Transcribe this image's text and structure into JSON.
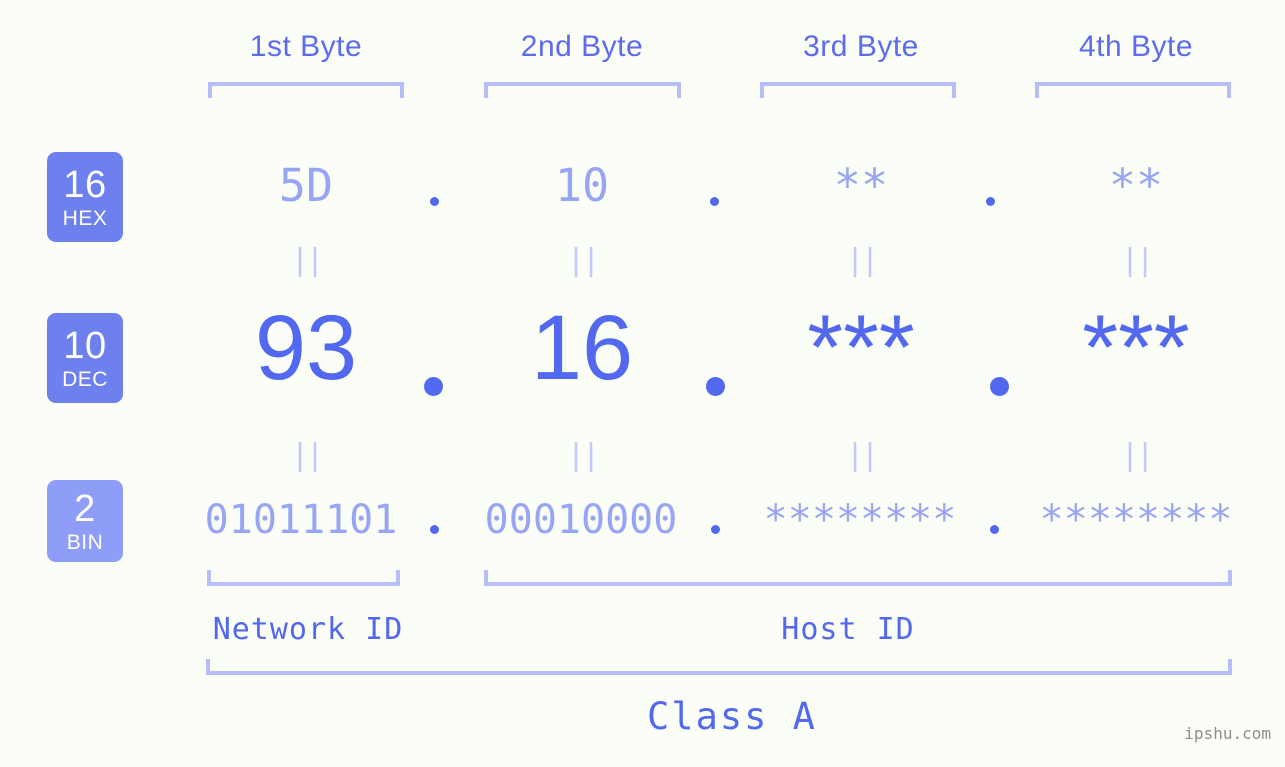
{
  "meta": {
    "background_color": "#fbfdf7",
    "accent_color": "#5268ef",
    "accent_light_color": "#98a5f4",
    "bracket_color": "#b6bdf8",
    "badge_color": "#6d80ee",
    "badge_light_color": "#8e9df7"
  },
  "headers": [
    {
      "label": "1st Byte"
    },
    {
      "label": "2nd Byte"
    },
    {
      "label": "3rd Byte"
    },
    {
      "label": "4th Byte"
    }
  ],
  "rows": {
    "hex": {
      "base": "16",
      "base_label": "HEX",
      "badge_color": "#6d80ee",
      "values": [
        "5D",
        "10",
        "**",
        "**"
      ],
      "separator": "."
    },
    "dec": {
      "base": "10",
      "base_label": "DEC",
      "badge_color": "#6d80ee",
      "values": [
        "93",
        "16",
        "***",
        "***"
      ],
      "separator": "."
    },
    "bin": {
      "base": "2",
      "base_label": "BIN",
      "badge_color": "#8e9df7",
      "values": [
        "01011101",
        "00010000",
        "********",
        "********"
      ],
      "separator": "."
    }
  },
  "equals_marker": "||",
  "sections": [
    {
      "label": "Network ID"
    },
    {
      "label": "Host ID"
    }
  ],
  "class": {
    "label": "Class A"
  },
  "watermark": {
    "text": "ipshu.com"
  }
}
